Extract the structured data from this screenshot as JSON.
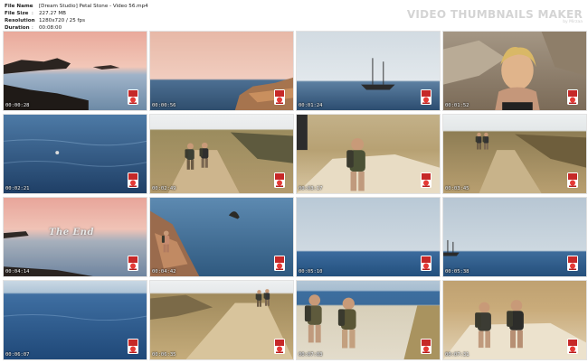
{
  "header": {
    "fields": [
      {
        "label": "File Name",
        "value": "[Dream Studio] Petal Stone - Video 56.mp4"
      },
      {
        "label": "File Size",
        "value": "227.27 MB"
      },
      {
        "label": "Resolution",
        "value": "1280x720 / 25 fps"
      },
      {
        "label": "Duration",
        "value": "00:08:00"
      }
    ],
    "separator": ":",
    "brand": "VIDEO THUMBNAILS MAKER",
    "brand_sub": "by Mirzaa"
  },
  "thumbnails": [
    {
      "timestamp": "00:00:28",
      "scene": "sunset-rocks"
    },
    {
      "timestamp": "00:00:56",
      "scene": "sea-cliff"
    },
    {
      "timestamp": "00:01:24",
      "scene": "sailboat"
    },
    {
      "timestamp": "00:01:52",
      "scene": "girl-rocks"
    },
    {
      "timestamp": "00:02:21",
      "scene": "open-water"
    },
    {
      "timestamp": "00:02:49",
      "scene": "hikers-path"
    },
    {
      "timestamp": "00:03:17",
      "scene": "hiker-close"
    },
    {
      "timestamp": "00:03:45",
      "scene": "hikers-far"
    },
    {
      "timestamp": "00:04:14",
      "scene": "the-end",
      "overlay_text": "The End"
    },
    {
      "timestamp": "00:04:42",
      "scene": "sea-rock"
    },
    {
      "timestamp": "00:05:10",
      "scene": "calm-sea"
    },
    {
      "timestamp": "00:05:38",
      "scene": "sailboat-far"
    },
    {
      "timestamp": "00:06:07",
      "scene": "open-sea"
    },
    {
      "timestamp": "00:06:35",
      "scene": "plateau-hikers"
    },
    {
      "timestamp": "00:07:03",
      "scene": "hikers-road"
    },
    {
      "timestamp": "00:07:31",
      "scene": "hikers-field"
    }
  ]
}
